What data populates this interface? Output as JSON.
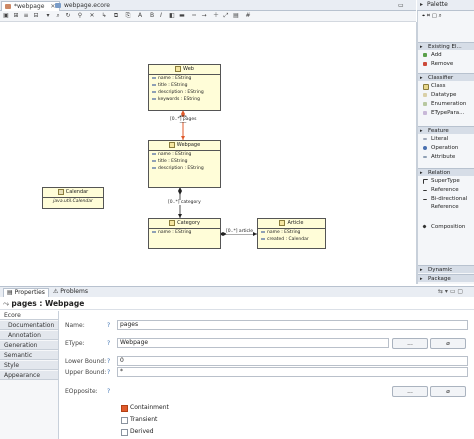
{
  "editor": {
    "tabs": [
      {
        "label": "*webpage",
        "active": true
      },
      {
        "label": "webpage.ecore",
        "active": false
      }
    ],
    "toolbar_font_bold": "B",
    "toolbar_font_italic": "I"
  },
  "diagram": {
    "classes": [
      {
        "name": "Web",
        "attributes": [
          "name : EString",
          "title : EString",
          "description : EString",
          "keywords : EString"
        ]
      },
      {
        "name": "Webpage",
        "attributes": [
          "name : EString",
          "title : EString",
          "description : EString"
        ]
      },
      {
        "name": "Category",
        "attributes": [
          "name : EString"
        ]
      },
      {
        "name": "Article",
        "attributes": [
          "name : EString",
          "created : Calendar"
        ]
      },
      {
        "name": "Calendar",
        "subtitle": "java.util.Calendar"
      }
    ],
    "edges": [
      {
        "label": "[0..*] pages",
        "from": "Web",
        "to": "Webpage"
      },
      {
        "label": "[0..*] category",
        "from": "Webpage",
        "to": "Category"
      },
      {
        "label": "[0..*] article",
        "from": "Category",
        "to": "Article"
      }
    ]
  },
  "palette": {
    "title": "Palette",
    "drawers": [
      {
        "label": "Existing El...",
        "items": [
          "Add",
          "Remove"
        ]
      },
      {
        "label": "Classifier",
        "items": [
          "Class",
          "Datatype",
          "Enumeration",
          "ETypePara..."
        ]
      },
      {
        "label": "Feature",
        "items": [
          "Literal",
          "Operation",
          "Attribute"
        ]
      },
      {
        "label": "Relation",
        "items": [
          "SuperType",
          "Reference",
          "Bi-directional Reference",
          "Composition"
        ]
      },
      {
        "label": "Dynamic",
        "items": []
      },
      {
        "label": "Package",
        "items": []
      }
    ]
  },
  "properties": {
    "tabs_bar": {
      "properties": "Properties",
      "problems": "Problems"
    },
    "title": "pages : Webpage",
    "side_tabs": [
      "Ecore",
      "Documentation",
      "Annotation",
      "Generation",
      "Semantic",
      "Style",
      "Appearance"
    ],
    "fields": {
      "name_label": "Name:",
      "name_value": "pages",
      "etype_label": "EType:",
      "etype_value": "Webpage",
      "lower_label": "Lower Bound:",
      "lower_value": "0",
      "upper_label": "Upper Bound:",
      "upper_value": "*",
      "eopposite_label": "EOpposite:",
      "help": "?",
      "browse_button": "...",
      "clear_button": "⌀"
    },
    "checkboxes": [
      {
        "label": "Containment",
        "checked": true
      },
      {
        "label": "Transient",
        "checked": false
      },
      {
        "label": "Derived",
        "checked": false
      }
    ]
  }
}
